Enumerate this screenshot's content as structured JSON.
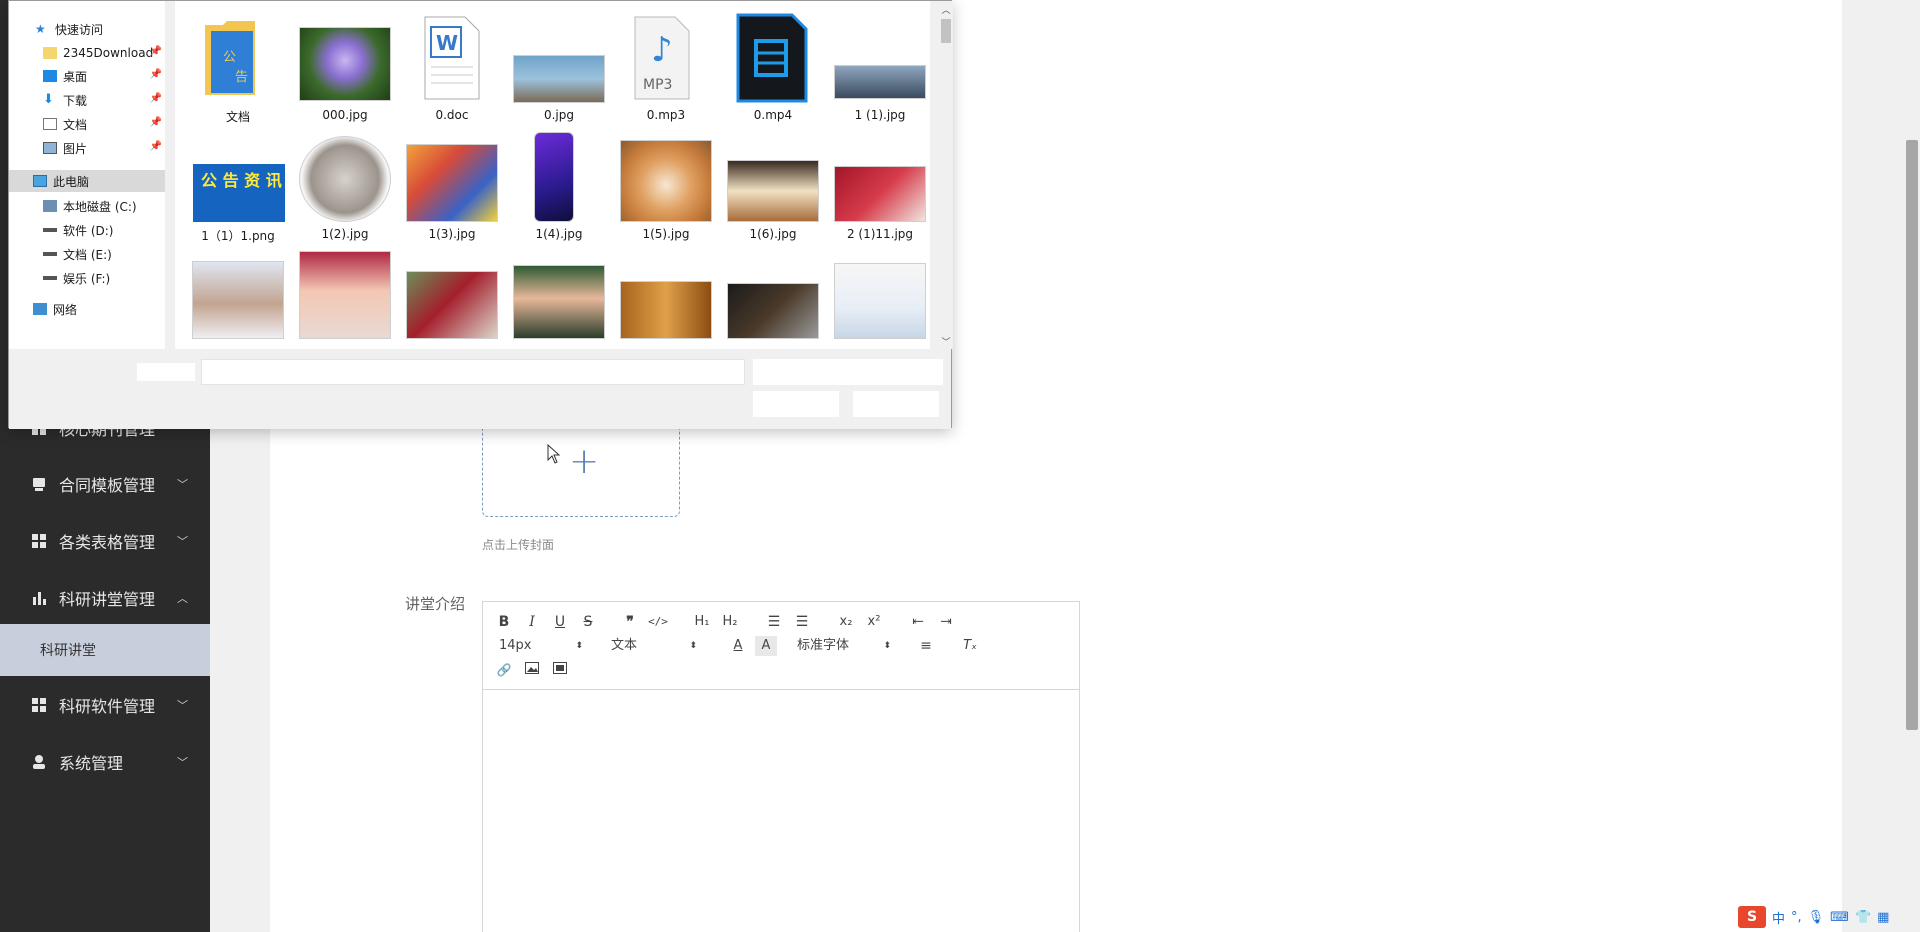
{
  "sidebar": {
    "items": [
      {
        "label": "核心期刊管理"
      },
      {
        "label": "合同模板管理"
      },
      {
        "label": "各类表格管理"
      },
      {
        "label": "科研讲堂管理"
      },
      {
        "label": "科研软件管理"
      },
      {
        "label": "系统管理"
      }
    ],
    "subitem": "科研讲堂"
  },
  "form": {
    "upload_tip": "点击上传封面",
    "intro_label": "讲堂介绍"
  },
  "editor": {
    "font_size": "14px",
    "paragraph": "文本",
    "font_family": "标准字体"
  },
  "dialog": {
    "nav": [
      {
        "label": "快速访问"
      },
      {
        "label": "2345Download"
      },
      {
        "label": "桌面"
      },
      {
        "label": "下载"
      },
      {
        "label": "文档"
      },
      {
        "label": "图片"
      },
      {
        "label": "此电脑"
      },
      {
        "label": "本地磁盘 (C:)"
      },
      {
        "label": "软件 (D:)"
      },
      {
        "label": "文档 (E:)"
      },
      {
        "label": "娱乐 (F:)"
      },
      {
        "label": "网络"
      }
    ],
    "files": [
      {
        "name": "文档"
      },
      {
        "name": "000.jpg"
      },
      {
        "name": "0.doc"
      },
      {
        "name": "0.jpg"
      },
      {
        "name": "0.mp3"
      },
      {
        "name": "0.mp4"
      },
      {
        "name": "1 (1).jpg"
      },
      {
        "name": "1（1）1.png"
      },
      {
        "name": "1(2).jpg"
      },
      {
        "name": "1(3).jpg"
      },
      {
        "name": "1(4).jpg"
      },
      {
        "name": "1(5).jpg"
      },
      {
        "name": "1(6).jpg"
      },
      {
        "name": "2 (1)11.jpg"
      }
    ],
    "folder_text": "公告资讯",
    "mp3_label": "MP3",
    "notice_text": "公 告 资 讯"
  },
  "ime": {
    "logo": "S",
    "lang": "中"
  },
  "colors": {
    "sidebar_bg": "#2b2b2b",
    "sidebar_active": "#c8cfdc",
    "accent": "#5b7fb3"
  }
}
